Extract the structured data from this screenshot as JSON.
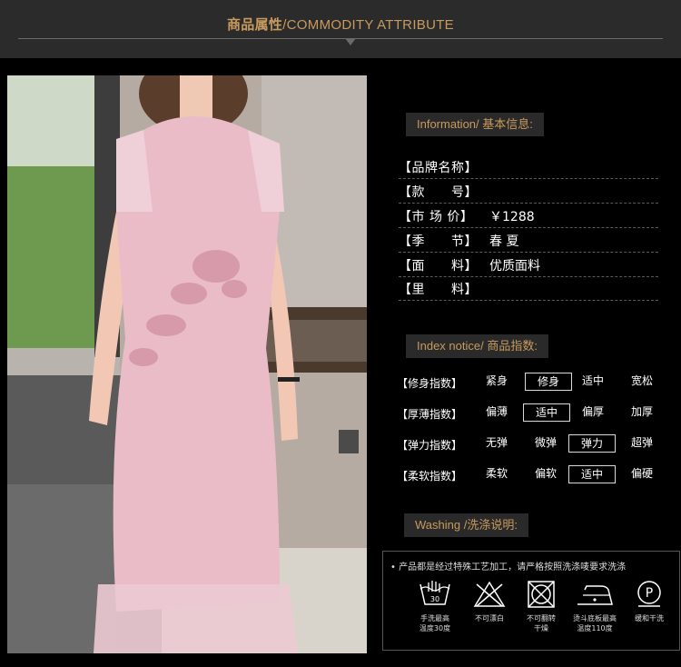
{
  "header": {
    "title_cn": "商品属性",
    "title_en": "/COMMODITY ATTRIBUTE"
  },
  "photo": {
    "subject": "pink embroidered qipao dress"
  },
  "info": {
    "tag": "Information/ 基本信息:",
    "rows": [
      {
        "label": "【品牌名称】",
        "value": ""
      },
      {
        "label": "【款　　号】",
        "value": ""
      },
      {
        "label": "【市 场 价】",
        "value": "￥1288"
      },
      {
        "label": "【季　　节】",
        "value": "春 夏"
      },
      {
        "label": "【面　　料】",
        "value": "优质面料"
      },
      {
        "label": "【里　　料】",
        "value": ""
      }
    ]
  },
  "index": {
    "tag": "Index notice/ 商品指数:",
    "rows": [
      {
        "label": "【修身指数】",
        "options": [
          "紧身",
          "修身",
          "适中",
          "宽松"
        ],
        "selected": 1
      },
      {
        "label": "【厚薄指数】",
        "options": [
          "偏薄",
          "适中",
          "偏厚",
          "加厚"
        ],
        "selected": 1
      },
      {
        "label": "【弹力指数】",
        "options": [
          "无弹",
          "微弹",
          "弹力",
          "超弹"
        ],
        "selected": 2
      },
      {
        "label": "【柔软指数】",
        "options": [
          "柔软",
          "偏软",
          "适中",
          "偏硬"
        ],
        "selected": 2
      }
    ]
  },
  "washing": {
    "tag": "Washing /洗涤说明:",
    "note": "• 产品都是经过特殊工艺加工，请严格按照洗涤唛要求洗涤",
    "items": [
      {
        "icon": "hand-wash-30-icon",
        "caption_1": "手洗最高",
        "caption_2": "温度30度"
      },
      {
        "icon": "no-bleach-icon",
        "caption_1": "不可漂白",
        "caption_2": ""
      },
      {
        "icon": "no-tumble-dry-icon",
        "caption_1": "不可翻转",
        "caption_2": "干燥"
      },
      {
        "icon": "iron-icon",
        "caption_1": "烫斗底板最高",
        "caption_2": "温度110度"
      },
      {
        "icon": "dry-clean-p-icon",
        "caption_1": "缓和干洗",
        "caption_2": ""
      }
    ]
  },
  "colors": {
    "accent": "#c79a5e",
    "dress": "#e9bcc8"
  }
}
